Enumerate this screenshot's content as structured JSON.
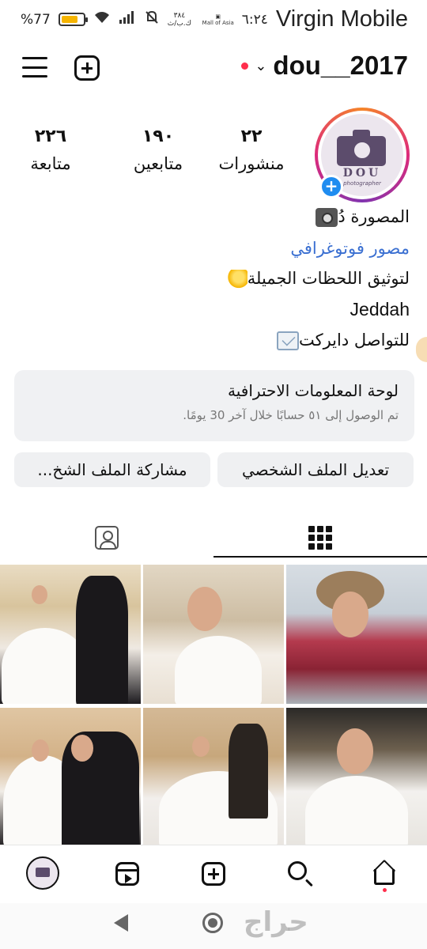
{
  "status_bar": {
    "battery": "77",
    "battery_percent_sign": "%",
    "battery_level": 0.77,
    "net_speed": "٣٨٤",
    "net_speed_unit": "ك.ب/ث",
    "mall_text": "Mall of Asia",
    "time": "٦:٢٤",
    "carrier": "Virgin Mobile"
  },
  "header": {
    "username": "dou__2017",
    "dropdown_icon": "chevron-down-icon",
    "notification_dot_color": "#ff2e4c"
  },
  "avatar": {
    "logo_text": "DOU",
    "logo_subtext": "photographer"
  },
  "stats": {
    "posts": {
      "count": "٢٢",
      "label": "منشورات"
    },
    "followers": {
      "count": "١٩٠",
      "label": "متابعين"
    },
    "following": {
      "count": "٢٢٦",
      "label": "متابعة"
    }
  },
  "bio": {
    "name": "المصورة دُ",
    "category": "مصور فوتوغرافي",
    "line1": "لتوثيق اللحظات الجميلة",
    "line2": "Jeddah",
    "line3": "للتواصل دايركت"
  },
  "dashboard": {
    "title": "لوحة المعلومات الاحترافية",
    "subtitle": "تم الوصول إلى ٥١ حسابًا خلال آخر 30 يومًا."
  },
  "buttons": {
    "edit_profile": "تعديل الملف الشخصي",
    "share_profile": "مشاركة الملف الشخ..."
  },
  "tabs": [
    {
      "name": "grid",
      "icon": "grid-icon",
      "active": true
    },
    {
      "name": "tagged",
      "icon": "tagged-person-icon",
      "active": false
    }
  ],
  "bottom_nav": [
    "profile",
    "reels",
    "create",
    "search",
    "home"
  ],
  "watermark": "حراج",
  "colors": {
    "accent_blue": "#1f8cf0",
    "link_blue": "#3a6fd1",
    "card_bg": "#f0f1f3"
  }
}
